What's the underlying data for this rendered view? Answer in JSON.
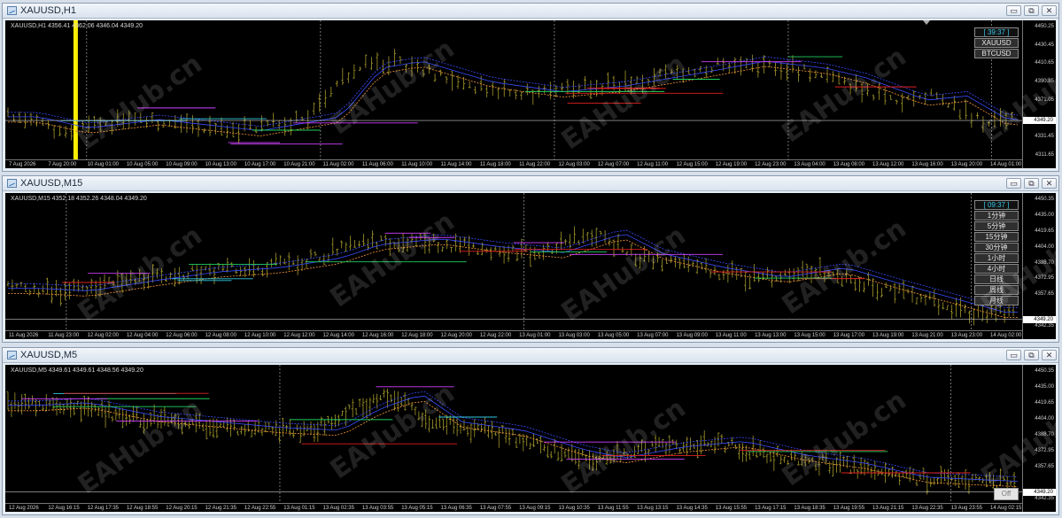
{
  "windows": [
    {
      "title": "XAUUSD,H1",
      "info": "XAUUSD,H1  4356.41 4362.06 4346.04 4349.20",
      "timer": "[ 39:37 ]",
      "buttons": [
        "XAUUSD",
        "BTCUSD"
      ],
      "price_labels": [
        "4450.25",
        "4430.45",
        "4410.65",
        "4390.85",
        "4371.05",
        "4349.20",
        "4331.45",
        "4311.65"
      ],
      "bid": "4349.20",
      "time_labels": [
        "7 Aug 2026",
        "7 Aug 20:00",
        "10 Aug 01:00",
        "10 Aug 05:00",
        "10 Aug 09:00",
        "10 Aug 13:00",
        "10 Aug 17:00",
        "10 Aug 21:00",
        "11 Aug 02:00",
        "11 Aug 06:00",
        "11 Aug 10:00",
        "11 Aug 14:00",
        "11 Aug 18:00",
        "11 Aug 22:00",
        "12 Aug 03:00",
        "12 Aug 07:00",
        "12 Aug 11:00",
        "12 Aug 15:00",
        "12 Aug 19:00",
        "12 Aug 23:00",
        "13 Aug 04:00",
        "13 Aug 08:00",
        "13 Aug 12:00",
        "13 Aug 16:00",
        "13 Aug 20:00",
        "14 Aug 01:00"
      ]
    },
    {
      "title": "XAUUSD,M15",
      "info": "XAUUSD,M15  4352.18 4352.26 4348.04 4349.20",
      "timer": "[ 09:37 ]",
      "buttons": [
        "1分钟",
        "5分钟",
        "15分钟",
        "30分钟",
        "1小时",
        "4小时",
        "日线",
        "周线",
        "月线"
      ],
      "price_labels": [
        "4450.35",
        "4435.00",
        "4419.65",
        "4404.00",
        "4388.70",
        "4372.95",
        "4357.65",
        "4349.20",
        "4342.35"
      ],
      "bid": "4349.20",
      "time_labels": [
        "11 Aug 2026",
        "11 Aug 23:00",
        "12 Aug 02:00",
        "12 Aug 04:00",
        "12 Aug 06:00",
        "12 Aug 08:00",
        "12 Aug 10:00",
        "12 Aug 12:00",
        "12 Aug 14:00",
        "12 Aug 16:00",
        "12 Aug 18:00",
        "12 Aug 20:00",
        "12 Aug 22:00",
        "13 Aug 01:00",
        "13 Aug 03:00",
        "13 Aug 05:00",
        "13 Aug 07:00",
        "13 Aug 09:00",
        "13 Aug 11:00",
        "13 Aug 13:00",
        "13 Aug 15:00",
        "13 Aug 17:00",
        "13 Aug 19:00",
        "13 Aug 21:00",
        "13 Aug 23:00",
        "14 Aug 02:00"
      ]
    },
    {
      "title": "XAUUSD,M5",
      "info": "XAUUSD,M5  4349.61 4349.61 4348.56 4349.20",
      "off_label": "Off",
      "price_labels": [
        "4450.35",
        "4435.00",
        "4419.65",
        "4404.00",
        "4388.70",
        "4372.95",
        "4357.65",
        "4349.20",
        "4342.35"
      ],
      "bid": "4349.20",
      "time_labels": [
        "12 Aug 2026",
        "12 Aug 16:15",
        "12 Aug 17:35",
        "12 Aug 18:55",
        "12 Aug 20:15",
        "12 Aug 21:35",
        "12 Aug 22:55",
        "13 Aug 01:15",
        "13 Aug 02:35",
        "13 Aug 03:55",
        "13 Aug 05:15",
        "13 Aug 06:35",
        "13 Aug 07:55",
        "13 Aug 09:15",
        "13 Aug 10:35",
        "13 Aug 11:55",
        "13 Aug 13:15",
        "13 Aug 14:35",
        "13 Aug 15:55",
        "13 Aug 17:15",
        "13 Aug 18:35",
        "13 Aug 19:55",
        "13 Aug 21:15",
        "13 Aug 22:35",
        "13 Aug 23:55",
        "14 Aug 02:15"
      ]
    }
  ],
  "watermark": "EAHub.cn",
  "window_controls": [
    "▭",
    "⧉",
    "✕"
  ],
  "colors": {
    "candle": "#a59a2a",
    "bid_line": "#c8c8c8",
    "highlight": "#ffee00",
    "blue": "#3a4cff",
    "orange": "#ff9a3a",
    "red": "#e02020",
    "magenta": "#d040ff",
    "green": "#20d060",
    "cyan": "#30c8e0"
  }
}
